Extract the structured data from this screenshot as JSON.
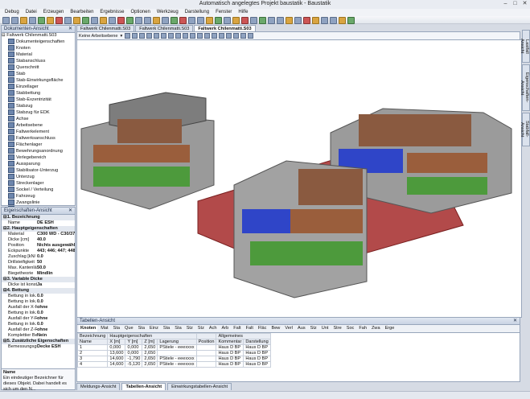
{
  "window": {
    "title": "Automatisch angelegtes Projekt baustatik - Baustatik"
  },
  "menu": [
    "Debug",
    "Datei",
    "Erzeugen",
    "Bearbeiten",
    "Ergebnisse",
    "Optionen",
    "Werkzeug",
    "Darstellung",
    "Fenster",
    "Hilfe"
  ],
  "doc_tree": {
    "header": "Dokumenten-Ansicht",
    "root": "Faltwerk Chilenmatti.S03",
    "items": [
      "Dokumenteigenschaften",
      "Knoten",
      "Material",
      "Stabanschluss",
      "Querschnitt",
      "Stab",
      "Stab-Einwirkungsfläche",
      "Einzellager",
      "Stabbettung",
      "Stab-Exzentrizität",
      "Stabzug",
      "Stabzug für EDK",
      "Achse",
      "Arbeitsebene",
      "Faltwerkelement",
      "Faltwerksanschluss",
      "Flächenlager",
      "Bewehrungsanordnung",
      "Verlegebereich",
      "Aussparung",
      "Stabilisator-Unterzug",
      "Unterzug",
      "Streckenlager",
      "Sockel / Verteilung",
      "Fahrzeug",
      "Zwangslinie",
      "Ergebnislinie"
    ]
  },
  "properties": {
    "header": "Eigenschaften-Ansicht",
    "sections": [
      {
        "title": "1. Bezeichnung",
        "rows": [
          [
            "Name",
            "DE ESH"
          ]
        ]
      },
      {
        "title": "2. Hauptgeigenschaften",
        "rows": [
          [
            "Material",
            "C300 WD - C30/37"
          ],
          [
            "Dicke [cm]",
            "40.0"
          ],
          [
            "Position",
            "Nichts ausgewählt"
          ],
          [
            "Eckpunkte",
            "443; 446; 447; 448;"
          ],
          [
            "Zuschlag [kN/",
            "0.0"
          ],
          [
            "Drillsteifigkeit",
            "50"
          ],
          [
            "Max. Kantenlä",
            "50.0"
          ],
          [
            "Biegetheorie",
            "Mindlin"
          ]
        ]
      },
      {
        "title": "3. Variable Dicke",
        "rows": [
          [
            "Dicke ist konst",
            "Ja"
          ]
        ]
      },
      {
        "title": "4. Bettung",
        "rows": [
          [
            "Bettung in lok.",
            "0.0"
          ],
          [
            "Bettung in lok.",
            "0.0"
          ],
          [
            "Ausfall der X-R",
            "ohne"
          ],
          [
            "Bettung in lok.",
            "0.0"
          ],
          [
            "Ausfall der Y-R",
            "ohne"
          ],
          [
            "Bettung in lok.",
            "0.0"
          ],
          [
            "Ausfall der Z-R",
            "ohne"
          ],
          [
            "Komplettier Be",
            "Nein"
          ]
        ]
      },
      {
        "title": "5. Zusätzliche Eigenschaften",
        "rows": [
          [
            "Bemessungsgr",
            "Decke ESH"
          ]
        ]
      }
    ],
    "desc_title": "Name",
    "desc_text": "Ein eindeutiger Bezeichner für dieses Objekt. Dabei handelt es sich um den N..."
  },
  "view_tabs": [
    "Faltwerk Chilenmatti.S03",
    "Faltwerk Chilenmatti.S03",
    "Faltwerk Chilenmatti.S03"
  ],
  "view_toolbar_label": "Keine Arbeitsebene",
  "right_tabs": [
    "Lastfall Ansicht",
    "Eigenschaften-Ansicht",
    "Stabfall-Ansicht"
  ],
  "table_view": {
    "header": "Tabellen-Ansicht",
    "tabs": [
      "Knoten",
      "Mat",
      "Sta",
      "Que",
      "Sta",
      "Einz",
      "Sta",
      "Sta",
      "Stz",
      "Stz",
      "Ach",
      "Arb",
      "Falt",
      "Falt",
      "Fläc",
      "Bew",
      "Verl",
      "Aus",
      "Stz",
      "Unt",
      "Stre",
      "Soc",
      "Fah",
      "Zwa",
      "Erge"
    ],
    "group_headers": [
      "Bezeichnung",
      "Hauptgeigenschaften",
      "Allgemeines"
    ],
    "columns": [
      "Name",
      "X [m]",
      "Y [m]",
      "Z [m]",
      "Lagerung",
      "Position",
      "Kommentar",
      "Darstellung"
    ],
    "rows": [
      [
        "1",
        "0,000",
        "0,000",
        "2,650",
        "PStiele - eeexxxx",
        "",
        "Haus D BP",
        "Haus D BP"
      ],
      [
        "2",
        "13,600",
        "0,000",
        "2,650",
        "",
        "",
        "Haus D BP",
        "Haus D BP"
      ],
      [
        "3",
        "14,600",
        "-1,790",
        "2,650",
        "PStiele - eeexxxx",
        "",
        "Haus D BP",
        "Haus D BP"
      ],
      [
        "4",
        "14,600",
        "-5,120",
        "2,650",
        "PStiele - eeexxxx",
        "",
        "Haus D BP",
        "Haus D BP"
      ]
    ]
  },
  "bottom_tabs": [
    "Meldungs-Ansicht",
    "Tabellen-Ansicht",
    "Einwirkungstabellen-Ansicht"
  ]
}
